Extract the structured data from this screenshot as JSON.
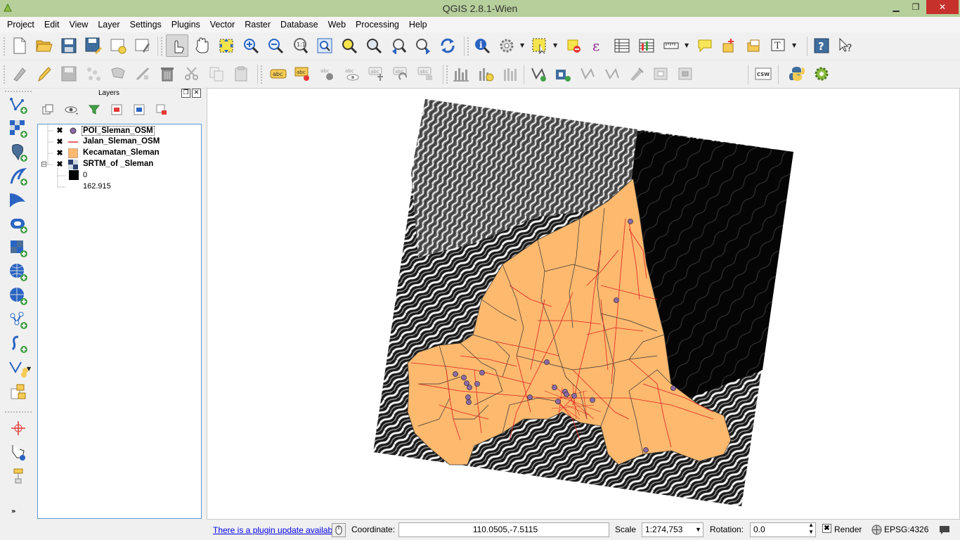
{
  "window": {
    "title": "QGIS 2.8.1-Wien",
    "minimize": "▁",
    "maximize": "❐",
    "close": "✕"
  },
  "menu": [
    "Project",
    "Edit",
    "View",
    "Layer",
    "Settings",
    "Plugins",
    "Vector",
    "Raster",
    "Database",
    "Web",
    "Processing",
    "Help"
  ],
  "toolbar_icons": {
    "row1": [
      "new-project-icon",
      "open-project-icon",
      "save-project-icon",
      "save-as-icon",
      "new-print-composer-icon",
      "composer-manager-icon",
      "touch-zoom-pan-icon",
      "pan-icon",
      "pan-to-selection-icon",
      "zoom-in-icon",
      "zoom-out-icon",
      "zoom-native-icon",
      "zoom-full-icon",
      "zoom-to-selection-icon",
      "zoom-to-layer-icon",
      "zoom-last-icon",
      "zoom-next-icon",
      "refresh-icon",
      "identify-icon",
      "action-icon",
      "select-features-icon",
      "deselect-icon",
      "field-calculator-icon",
      "attribute-table-icon",
      "statistics-icon",
      "measure-icon",
      "map-tips-icon",
      "new-bookmark-icon",
      "show-bookmarks-icon",
      "text-annotation-icon",
      "help-icon",
      "whats-this-icon"
    ],
    "row2": [
      "current-edits-icon",
      "toggle-editing-icon",
      "save-edits-icon",
      "add-feature-icon",
      "move-feature-icon",
      "node-tool-icon",
      "delete-selected-icon",
      "cut-features-icon",
      "copy-features-icon",
      "paste-features-icon",
      "label-icon",
      "layer-labeling-icon",
      "pin-labels-icon",
      "show-hide-labels-icon",
      "move-label-icon",
      "rotate-label-icon",
      "change-label-icon",
      "raster-histogram-icon",
      "raster-local-stretch-icon",
      "raster-full-extent-icon",
      "new-shapefile-icon",
      "new-spatialite-icon",
      "digitize-icon",
      "simplify-icon",
      "add-ring-icon",
      "add-part-icon",
      "fill-ring-icon",
      "csw-icon",
      "python-console-icon",
      "plugin-gear-icon"
    ]
  },
  "left_toolbar_icons": [
    "add-vector-layer-icon",
    "add-raster-layer-icon",
    "add-postgis-layer-icon",
    "add-spatialite-layer-icon",
    "add-mssql-layer-icon",
    "add-oracle-layer-icon",
    "add-wms-layer-icon",
    "add-wcs-layer-icon",
    "add-wfs-layer-icon",
    "add-delimited-text-icon",
    "new-shapefile-layer-icon",
    "new-layer-group-icon",
    "georeferencer-icon",
    "gps-tools-icon",
    "coordinate-capture-icon",
    "more-tools-icon"
  ],
  "layers_panel": {
    "title": "Layers",
    "float_btn": "❐",
    "close_btn": "✕",
    "layers": [
      {
        "name": "POI_Sleman_OSM",
        "checked": "✖",
        "symbol": "point",
        "color": "#8e6aa8"
      },
      {
        "name": "Jalan_Sleman_OSM",
        "checked": "✖",
        "symbol": "line",
        "color": "#e03030"
      },
      {
        "name": "Kecamatan_Sleman",
        "checked": "✖",
        "symbol": "polygon",
        "color": "#fdb96e"
      },
      {
        "name": "SRTM_of _Sleman",
        "checked": "✖",
        "symbol": "raster",
        "color": "#000000"
      }
    ],
    "raster_legend": {
      "min": "0",
      "max": "162.915",
      "expander": "⊟"
    }
  },
  "map_colors": {
    "polygon_fill": "#fdb96e",
    "road": "#e02020",
    "poi": "#8e6aa8",
    "boundary": "#333333"
  },
  "status": {
    "plugin_update": "There is a plugin update available",
    "coordinate_label": "Coordinate:",
    "coordinate_value": "110.0505,-7.5115",
    "scale_label": "Scale",
    "scale_value": "1:274,753",
    "rotation_label": "Rotation:",
    "rotation_value": "0.0",
    "render_label": "Render",
    "render_checked": "✖",
    "epsg": "EPSG:4326"
  }
}
